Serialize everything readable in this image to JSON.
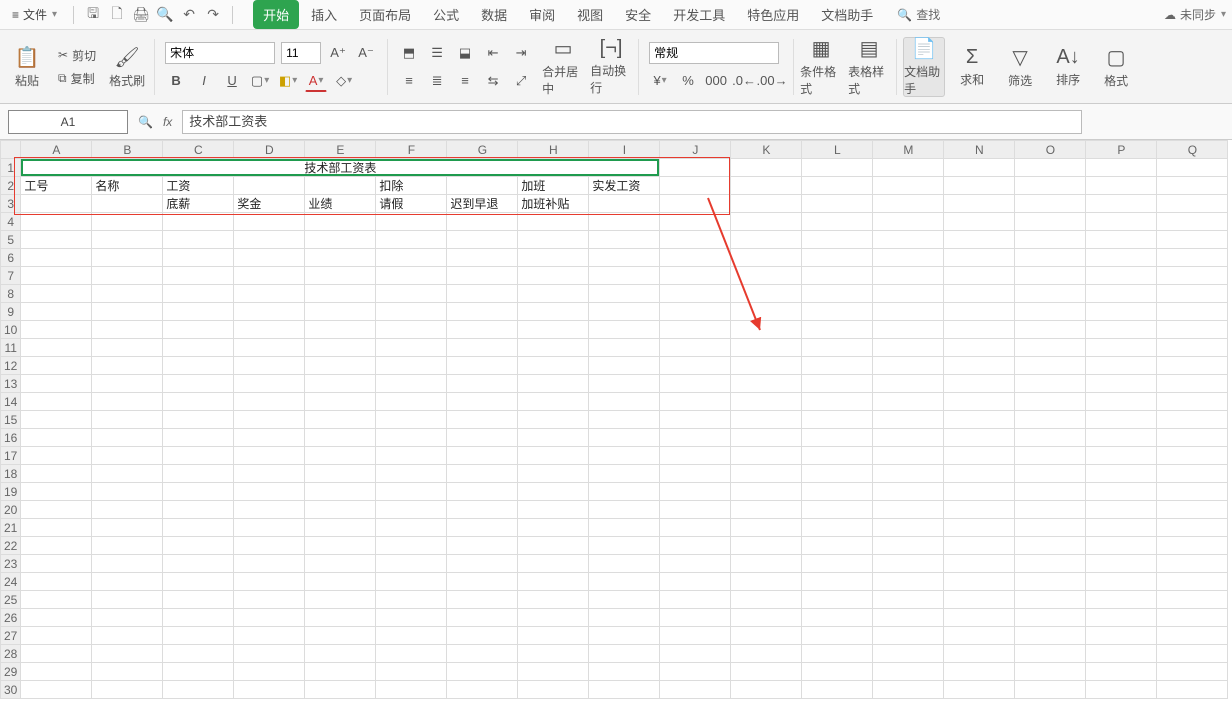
{
  "menubar": {
    "file_label": "文件",
    "search_label": "查找",
    "sync_label": "未同步"
  },
  "tabs": {
    "items": [
      {
        "label": "开始",
        "active": true
      },
      {
        "label": "插入"
      },
      {
        "label": "页面布局"
      },
      {
        "label": "公式"
      },
      {
        "label": "数据"
      },
      {
        "label": "审阅"
      },
      {
        "label": "视图"
      },
      {
        "label": "安全"
      },
      {
        "label": "开发工具"
      },
      {
        "label": "特色应用"
      },
      {
        "label": "文档助手"
      }
    ]
  },
  "ribbon": {
    "paste_label": "粘贴",
    "cut_label": "剪切",
    "copy_label": "复制",
    "fmtpaint_label": "格式刷",
    "font_name": "宋体",
    "font_size": "11",
    "merge_label": "合并居中",
    "wrap_label": "自动换行",
    "number_format": "常规",
    "cond_fmt_label": "条件格式",
    "table_style_label": "表格样式",
    "doc_helper_label": "文档助手",
    "sum_label": "求和",
    "filter_label": "筛选",
    "sort_label": "排序",
    "format_label": "格式"
  },
  "formula_bar": {
    "active_cell": "A1",
    "formula_value": "技术部工资表"
  },
  "column_headers": [
    "A",
    "B",
    "C",
    "D",
    "E",
    "F",
    "G",
    "H",
    "I",
    "J",
    "K",
    "L",
    "M",
    "N",
    "O",
    "P",
    "Q"
  ],
  "sheet": {
    "row1": {
      "title": "技术部工资表"
    },
    "row2": {
      "A": "工号",
      "B": "名称",
      "C": "工资",
      "F": "扣除",
      "H": "加班",
      "I": "实发工资"
    },
    "row3": {
      "C": "底薪",
      "D": "奖金",
      "E": "业绩",
      "F": "请假",
      "G": "迟到早退",
      "H": "加班补贴"
    }
  }
}
